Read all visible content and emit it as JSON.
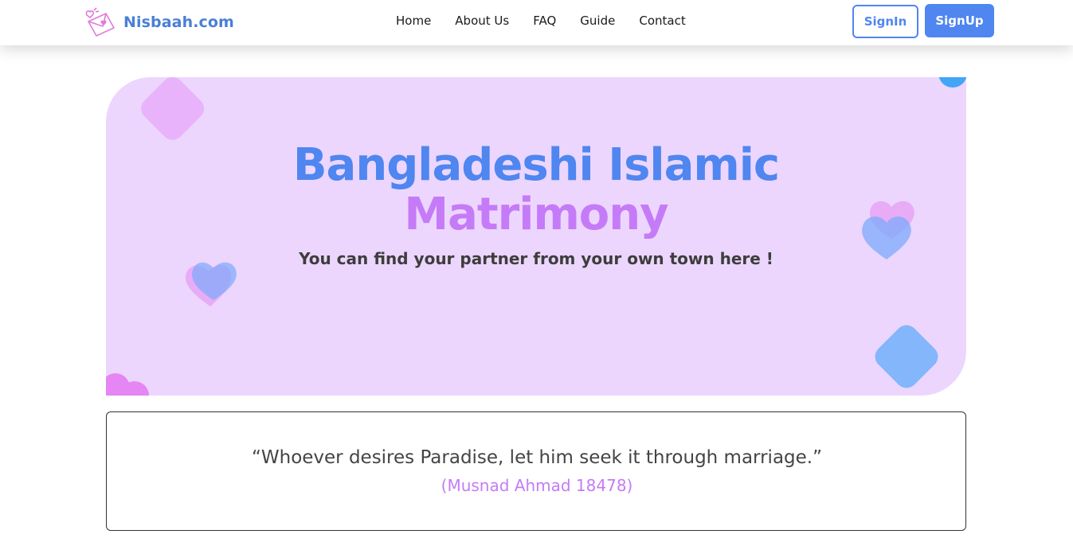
{
  "brand": {
    "name": "Nisbaah.com"
  },
  "nav": {
    "links": [
      "Home",
      "About Us",
      "FAQ",
      "Guide",
      "Contact"
    ],
    "signin_label": "SignIn",
    "signup_label": "SignUp"
  },
  "hero": {
    "title_line1": "Bangladeshi Islamic",
    "title_line2": "Matrimony",
    "subtitle": "You can find your partner from your own town here !"
  },
  "quote": {
    "text": "“Whoever desires Paradise, let him seek it through marriage.”",
    "reference": "(Musnad Ahmad 18478)"
  },
  "colors": {
    "accent_blue": "#4f86f0",
    "accent_purple": "#c57bf7",
    "hero_bg": "#ecd6fd"
  },
  "icons": [
    "envelope-heart-logo-icon",
    "heart-icon",
    "diamond-shape",
    "circle-shape"
  ]
}
